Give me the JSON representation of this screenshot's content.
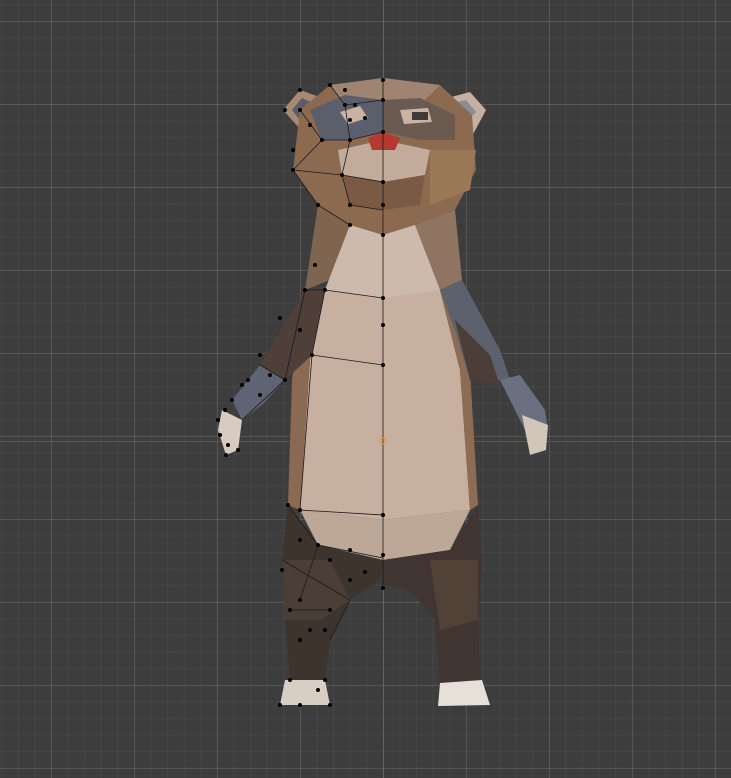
{
  "viewport": {
    "background": "#3d3d3d",
    "axis_x_color": "#9b3b3b",
    "axis_z_color": "#3c6ea5",
    "origin_color": "#e6903a"
  },
  "model": {
    "name": "",
    "colors": {
      "fur_brown": "#8a6a52",
      "fur_light": "#c9b4a4",
      "fur_dark": "#4a3d34",
      "mask_grey": "#5b5f6b",
      "nose_red": "#b23a32",
      "paw_white": "#e6e0d8",
      "edge": "#1a1a1a",
      "vertex": "#000000"
    }
  }
}
